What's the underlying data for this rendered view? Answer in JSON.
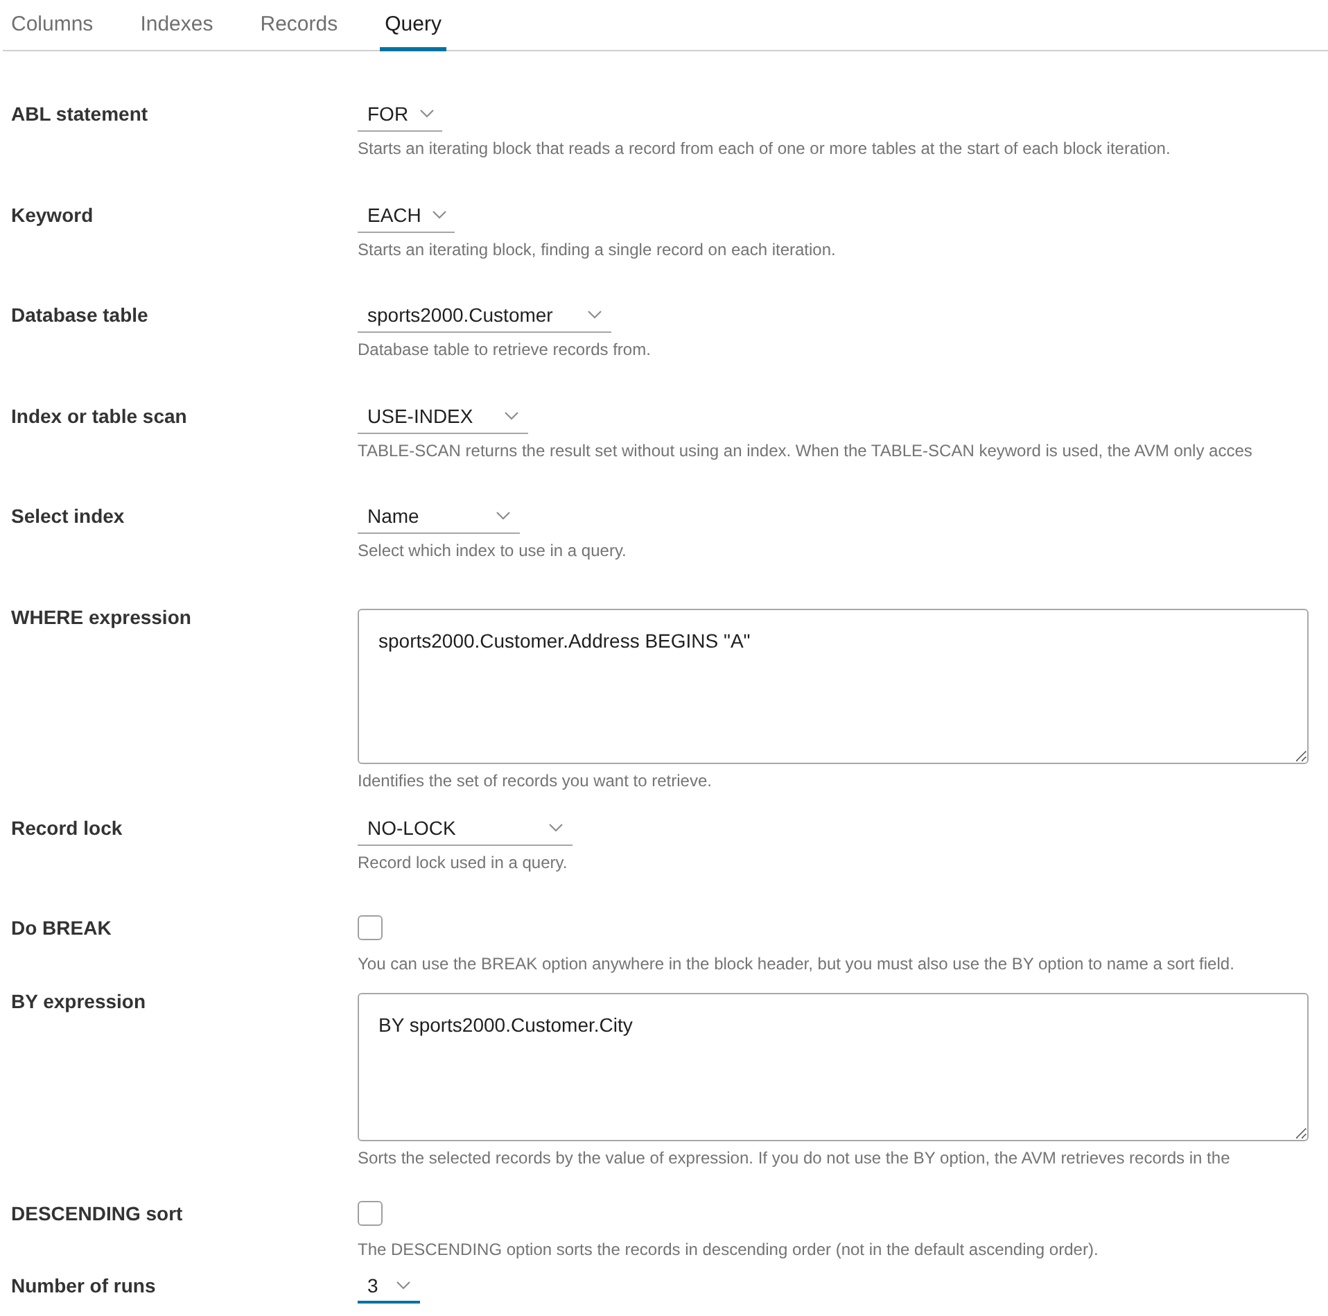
{
  "tabs": [
    {
      "label": "Columns",
      "selected": false
    },
    {
      "label": "Indexes",
      "selected": false
    },
    {
      "label": "Records",
      "selected": false
    },
    {
      "label": "Query",
      "selected": true
    }
  ],
  "fields": [
    {
      "kind": "select",
      "label": "ABL statement",
      "value": "FOR",
      "focused": false,
      "help": "Starts an iterating block that reads a record from each of one or more tables at the start of each block iteration."
    },
    {
      "kind": "select",
      "label": "Keyword",
      "value": "EACH",
      "focused": false,
      "help": "Starts an iterating block, finding a single record on each iteration."
    },
    {
      "kind": "select",
      "label": "Database table",
      "value": "sports2000.Customer",
      "focused": false,
      "help": "Database table to retrieve records from."
    },
    {
      "kind": "select",
      "label": "Index or table scan",
      "value": "USE-INDEX",
      "focused": false,
      "help": "TABLE-SCAN returns the result set without using an index. When the TABLE-SCAN keyword is used, the AVM only acces"
    },
    {
      "kind": "select",
      "label": "Select index",
      "value": "Name",
      "focused": false,
      "help": "Select which index to use in a query."
    },
    {
      "kind": "textarea",
      "label": "WHERE expression",
      "value": "sports2000.Customer.Address BEGINS \"A\"",
      "help": "Identifies the set of records you want to retrieve."
    },
    {
      "kind": "select",
      "label": "Record lock",
      "value": "NO-LOCK",
      "focused": false,
      "help": "Record lock used in a query."
    },
    {
      "kind": "checkbox",
      "label": "Do BREAK",
      "checked": false,
      "help": "You can use the BREAK option anywhere in the block header, but you must also use the BY option to name a sort field."
    },
    {
      "kind": "textarea",
      "label": "BY expression",
      "value": "BY sports2000.Customer.City",
      "help": "Sorts the selected records by the value of expression. If you do not use the BY option, the AVM retrieves records in the"
    },
    {
      "kind": "checkbox",
      "label": "DESCENDING sort",
      "checked": false,
      "help": "The DESCENDING option sorts the records in descending order (not in the default ascending order)."
    },
    {
      "kind": "select",
      "label": "Number of runs",
      "value": "3",
      "focused": true
    }
  ]
}
